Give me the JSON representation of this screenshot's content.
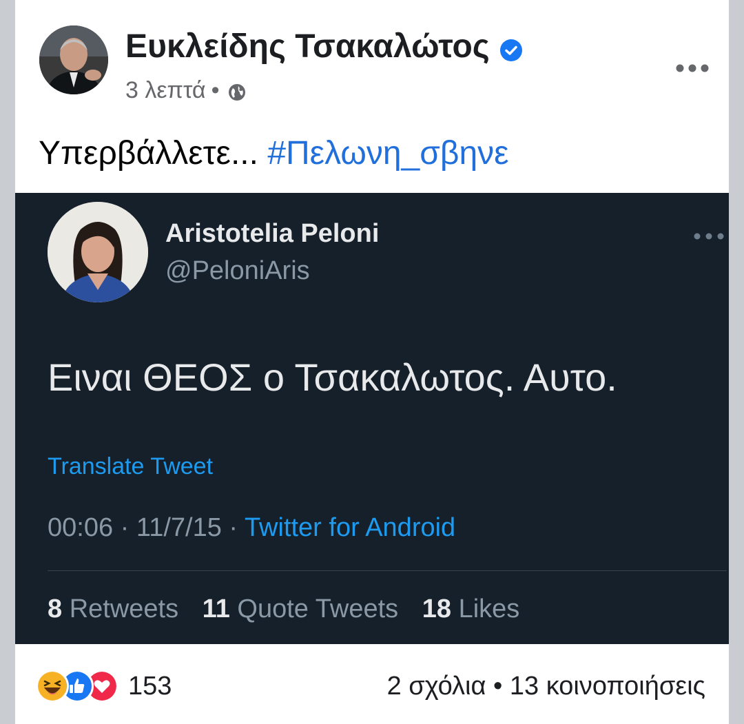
{
  "post": {
    "author": "Ευκλείδης Τσακαλώτος",
    "time": "3 λεπτά",
    "separator": "•",
    "text": "Υπερβάλλετε...",
    "hashtag": "#Πελωνη_σβηνε"
  },
  "tweet": {
    "name": "Aristotelia Peloni",
    "handle": "@PeloniAris",
    "text": "Ειναι ΘΕΟΣ ο Τσακαλωτος. Αυτο.",
    "translate": "Translate Tweet",
    "time": "00:06",
    "date": "11/7/15",
    "source": "Twitter for Android",
    "meta_sep": "·",
    "retweets_count": "8",
    "retweets_label": "Retweets",
    "quotes_count": "11",
    "quotes_label": "Quote Tweets",
    "likes_count": "18",
    "likes_label": "Likes"
  },
  "footer": {
    "reactions_count": "153",
    "comments": "2 σχόλια",
    "dot": "•",
    "shares": "13 κοινοποιήσεις"
  },
  "colors": {
    "link_blue": "#216fdb",
    "tweet_bg": "#15202b",
    "twitter_blue": "#1d9bf0"
  },
  "icons": [
    "verified-badge-icon",
    "globe-icon",
    "more-options-icon",
    "haha-reaction-icon",
    "like-reaction-icon",
    "love-reaction-icon"
  ]
}
